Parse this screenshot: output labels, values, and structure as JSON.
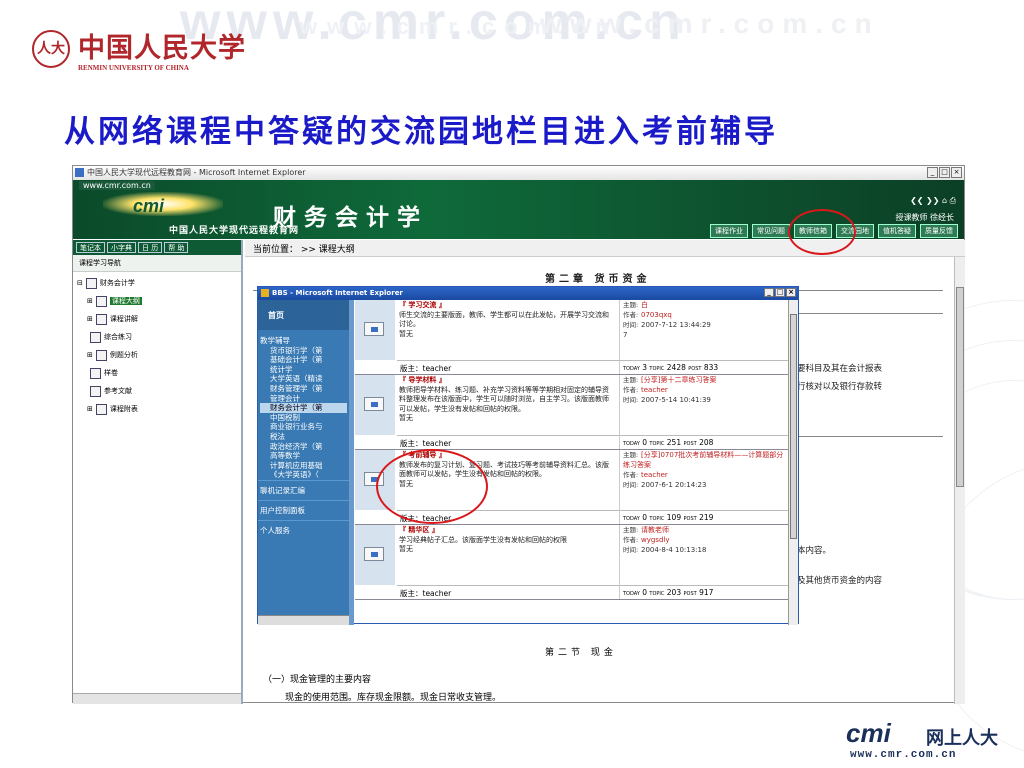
{
  "watermark": [
    "www.cmr.com.cn",
    "www.cmr.com.cn",
    "www.cmr.com.cn"
  ],
  "logo": {
    "seal": "人大",
    "cn": "中国人民大学",
    "en": "RENMIN UNIVERSITY OF CHINA"
  },
  "slide_title": "从网络课程中答疑的交流园地栏目进入考前辅导",
  "ie": {
    "title": "中国人民大学现代远程教育网 - Microsoft Internet Explorer",
    "controls": [
      "_",
      "□",
      "×"
    ],
    "banner_url": "www.cmr.com.cn",
    "banner_logo": "cmi",
    "course_title": "财务会计学",
    "univ": "中国人民大学现代远程教育网",
    "tools": "❮❮ ❯❯ ⌂ ⎙",
    "teacher": "授课教师 徐经长",
    "nav": [
      "课程作业",
      "常见问题",
      "教师信箱",
      "交流园地",
      "值机答疑",
      "质量反馈"
    ]
  },
  "left": {
    "buttons": [
      "笔记本",
      "小字典",
      "日 历",
      "帮 助"
    ],
    "heading": "课程学习导航",
    "tree": [
      {
        "label": "财务会计学",
        "level": 0,
        "prefix": "⊟"
      },
      {
        "label": "课程大纲",
        "level": 1,
        "prefix": "⊞",
        "active": true
      },
      {
        "label": "课程讲解",
        "level": 1,
        "prefix": "⊞"
      },
      {
        "label": "综合练习",
        "level": 1,
        "prefix": ""
      },
      {
        "label": "例题分析",
        "level": 1,
        "prefix": "⊞"
      },
      {
        "label": "样卷",
        "level": 1,
        "prefix": ""
      },
      {
        "label": "参考文献",
        "level": 1,
        "prefix": ""
      },
      {
        "label": "课程附表",
        "level": 1,
        "prefix": "⊞"
      }
    ]
  },
  "main": {
    "location": "当前位置： >> 课程大纲",
    "chapter": "第二章 货币资金",
    "bg_lines": [
      "要科目及其在会计报表",
      "行核对以及银行存款转",
      "本内容。",
      "及其他货币资金的内容"
    ],
    "section": "第二节 现金",
    "sub1": "（一）现金管理的主要内容",
    "sub2": "现金的使用范围。库存现金限额。现金日常收支管理。"
  },
  "bbs": {
    "title": "BBS - Microsoft Internet Explorer",
    "home": "首页",
    "list_head": "教学辅导",
    "list": [
      "货币银行学（第",
      "基础会计学（第",
      "统计学",
      "大学英语（精读",
      "财务管理学（第",
      "管理会计",
      "财务会计学（第",
      "中国税制",
      "商业银行业务与",
      "税法",
      "政治经济学（第",
      "高等数学",
      "计算机应用基础",
      "《大学英语》（"
    ],
    "list_selected": 6,
    "extras": [
      "聊机记录汇编",
      "用户控制面板",
      "个人服务"
    ],
    "rows": [
      {
        "title": "『 学习交流 』",
        "desc": "师生交流的主要版面，教师、学生都可以在此发帖，开展学习交流和讨论。",
        "mod_label": "暂无",
        "subject": "白",
        "author": "0703qxq",
        "time": "2007-7-12 13:44:29",
        "moderator": "版主：teacher",
        "today": "3",
        "topic": "2428",
        "post": "833",
        "extra": "7"
      },
      {
        "title": "『 导学材料 』",
        "desc": "教师把导学材料、练习题、补充学习资料等等学期相对固定的辅导资料整理发布在该版面中，学生可以随时浏览，自主学习。该版面教师可以发帖，学生没有发帖和回帖的权限。",
        "mod_label": "暂无",
        "subject": "[分享]第十二章练习答案",
        "author": "teacher",
        "time": "2007-5-14 10:41:39",
        "moderator": "版主：teacher",
        "today": "0",
        "topic": "251",
        "post": "208"
      },
      {
        "title": "『 考前辅导 』",
        "desc": "教师发布的复习计划、复习题、考试技巧等考前辅导资料汇总。该版面教师可以发帖，学生没有发帖和回帖的权限。",
        "mod_label": "暂无",
        "subject": "[分享]0707批次考前辅导材料——计算题部分练习答案",
        "author": "teacher",
        "time": "2007-6-1 20:14:23",
        "moderator": "版主：teacher",
        "today": "0",
        "topic": "109",
        "post": "219"
      },
      {
        "title": "『 精华区 』",
        "desc": "学习经典帖子汇总。该版面学生没有发帖和回帖的权限",
        "mod_label": "暂无",
        "subject": "请教老师",
        "author": "wygsdly",
        "time": "2004-8-4 10:13:18",
        "moderator": "版主：teacher",
        "today": "0",
        "topic": "203",
        "post": "917"
      }
    ],
    "labels": {
      "subject": "主题:",
      "author": "作者:",
      "time": "时间:",
      "today": "TODAY",
      "topic": "TOPIC",
      "post": "POST"
    }
  },
  "footer_logo": {
    "a": "cmi",
    "b": "网上人大",
    "c": "www.cmr.com.cn"
  }
}
